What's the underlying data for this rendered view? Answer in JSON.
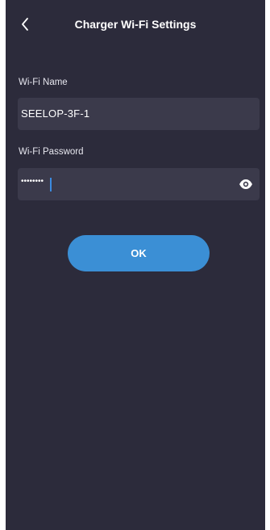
{
  "header": {
    "title": "Charger Wi-Fi Settings",
    "back_icon": "chevron-left-icon"
  },
  "form": {
    "wifi_name_label": "Wi-Fi Name",
    "wifi_name_value": "SEELOP-3F-1",
    "wifi_password_label": "Wi-Fi Password",
    "wifi_password_masked": "••••••••",
    "toggle_icon": "eye-icon"
  },
  "actions": {
    "ok_label": "OK"
  },
  "colors": {
    "background": "#2c2b3b",
    "field_background": "#3b3a4b",
    "accent": "#3b8fd5"
  }
}
